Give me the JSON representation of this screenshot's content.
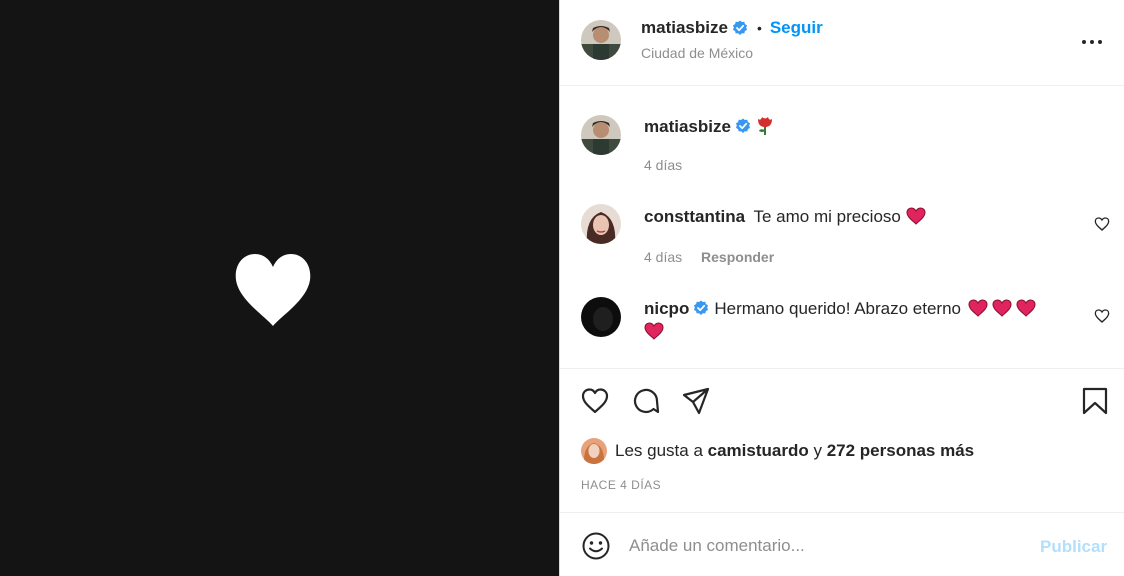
{
  "post": {
    "author": "matiasbize",
    "follow_label": "Seguir",
    "separator": "•",
    "location": "Ciudad de México"
  },
  "comments": [
    {
      "username": "matiasbize",
      "text": "",
      "emoji": "rose",
      "time": "4 días",
      "reply": "",
      "verified": true
    },
    {
      "username": "consttantina",
      "text": "Te amo mi precioso",
      "emoji": "red-heart",
      "time": "4 días",
      "reply": "Responder",
      "verified": false
    },
    {
      "username": "nicpo",
      "text": "Hermano querido! Abrazo eterno",
      "emoji": "red-heart x4",
      "verified": true
    }
  ],
  "likes": {
    "prefix": "Les gusta a",
    "user": "camistuardo",
    "connector": "y",
    "others": "272 personas más"
  },
  "timestamp": "HACE 4 DÍAS",
  "add_comment": {
    "placeholder": "Añade un comentario...",
    "post_label": "Publicar"
  },
  "colors": {
    "accent": "#0095f6",
    "post_disabled": "#b2dffc",
    "verified": "#3897f0",
    "heart_emoji": "#e0245e",
    "media_bg": "#141414"
  },
  "icons": [
    "more-options-icon",
    "verified-badge-icon",
    "like-heart-icon",
    "comment-icon",
    "share-icon",
    "save-bookmark-icon",
    "emoji-smile-icon",
    "rose-emoji-icon",
    "red-heart-emoji-icon"
  ]
}
